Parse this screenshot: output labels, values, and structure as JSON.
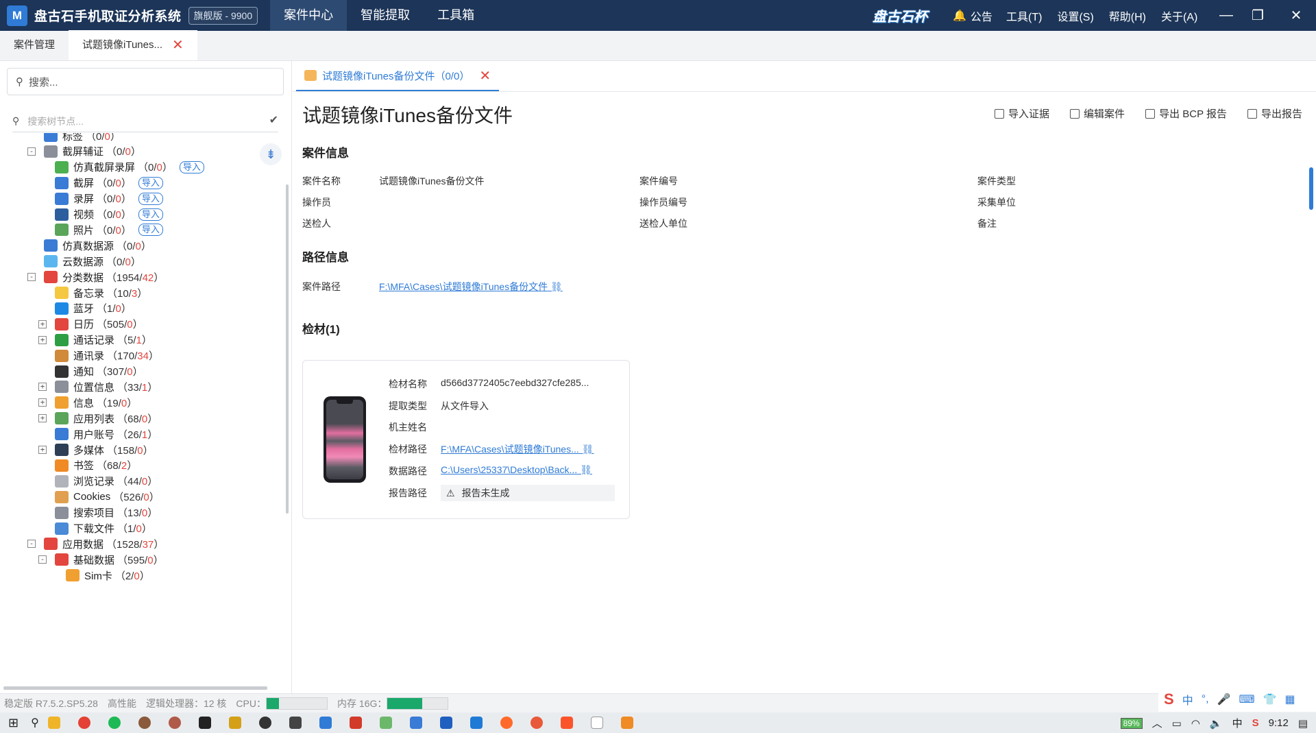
{
  "app": {
    "logo_letter": "M",
    "title": "盘古石手机取证分析系统",
    "edition": "旗舰版 - 9900",
    "brand": "盘古石杯"
  },
  "topnav": [
    "案件中心",
    "智能提取",
    "工具箱"
  ],
  "topbar": {
    "notice": "公告",
    "menus": [
      "工具(T)",
      "设置(S)",
      "帮助(H)",
      "关于(A)"
    ]
  },
  "tabs": [
    {
      "label": "案件管理"
    },
    {
      "label": "试题镜像iTunes..."
    }
  ],
  "left": {
    "search_placeholder": "搜索...",
    "tree_search_placeholder": "搜索树节点...",
    "tree": [
      {
        "label": "标签",
        "a": "0",
        "b": "0",
        "level": 1,
        "toggle": "",
        "color": "#3a7bd5",
        "icon": "tag-icon"
      },
      {
        "label": "截屏辅证",
        "a": "0",
        "b": "0",
        "level": 1,
        "toggle": "-",
        "color": "#8a8f99",
        "icon": "camera-icon"
      },
      {
        "label": "仿真截屏录屏",
        "a": "0",
        "b": "0",
        "level": 2,
        "toggle": "",
        "color": "#4caf50",
        "icon": "screen-record-icon",
        "import": "导入"
      },
      {
        "label": "截屏",
        "a": "0",
        "b": "0",
        "level": 2,
        "toggle": "",
        "color": "#3a7bd5",
        "icon": "screenshot-icon",
        "import": "导入"
      },
      {
        "label": "录屏",
        "a": "0",
        "b": "0",
        "level": 2,
        "toggle": "",
        "color": "#3a7bd5",
        "icon": "record-icon",
        "import": "导入"
      },
      {
        "label": "视频",
        "a": "0",
        "b": "0",
        "level": 2,
        "toggle": "",
        "color": "#2d5e9e",
        "icon": "video-icon",
        "import": "导入"
      },
      {
        "label": "照片",
        "a": "0",
        "b": "0",
        "level": 2,
        "toggle": "",
        "color": "#5aa55a",
        "icon": "photo-icon",
        "import": "导入"
      },
      {
        "label": "仿真数据源",
        "a": "0",
        "b": "0",
        "level": 1,
        "toggle": "",
        "color": "#3a7bd5",
        "icon": "simulation-icon"
      },
      {
        "label": "云数据源",
        "a": "0",
        "b": "0",
        "level": 1,
        "toggle": "",
        "color": "#5bb6f0",
        "icon": "cloud-icon"
      },
      {
        "label": "分类数据",
        "a": "1954",
        "b": "42",
        "level": 1,
        "toggle": "-",
        "color": "#e2463e",
        "icon": "category-icon"
      },
      {
        "label": "备忘录",
        "a": "10",
        "b": "3",
        "level": 2,
        "toggle": "",
        "color": "#f5c842",
        "icon": "memo-icon"
      },
      {
        "label": "蓝牙",
        "a": "1",
        "b": "0",
        "level": 2,
        "toggle": "",
        "color": "#1e88e5",
        "icon": "bluetooth-icon"
      },
      {
        "label": "日历",
        "a": "505",
        "b": "0",
        "level": 2,
        "toggle": "+",
        "color": "#e2463e",
        "icon": "calendar-icon"
      },
      {
        "label": "通话记录",
        "a": "5",
        "b": "1",
        "level": 2,
        "toggle": "+",
        "color": "#2e9e45",
        "icon": "phone-icon"
      },
      {
        "label": "通讯录",
        "a": "170",
        "b": "34",
        "level": 2,
        "toggle": "",
        "color": "#d08a3a",
        "icon": "contacts-icon"
      },
      {
        "label": "通知",
        "a": "307",
        "b": "0",
        "level": 2,
        "toggle": "",
        "color": "#333333",
        "icon": "bell-icon"
      },
      {
        "label": "位置信息",
        "a": "33",
        "b": "1",
        "level": 2,
        "toggle": "+",
        "color": "#8a8f99",
        "icon": "location-icon"
      },
      {
        "label": "信息",
        "a": "19",
        "b": "0",
        "level": 2,
        "toggle": "+",
        "color": "#f0a030",
        "icon": "message-icon"
      },
      {
        "label": "应用列表",
        "a": "68",
        "b": "0",
        "level": 2,
        "toggle": "+",
        "color": "#5aa55a",
        "icon": "app-list-icon"
      },
      {
        "label": "用户账号",
        "a": "26",
        "b": "1",
        "level": 2,
        "toggle": "",
        "color": "#3a7bd5",
        "icon": "user-icon"
      },
      {
        "label": "多媒体",
        "a": "158",
        "b": "0",
        "level": 2,
        "toggle": "+",
        "color": "#2d3e55",
        "icon": "media-icon"
      },
      {
        "label": "书签",
        "a": "68",
        "b": "2",
        "level": 2,
        "toggle": "",
        "color": "#f08a24",
        "icon": "bookmark-icon"
      },
      {
        "label": "浏览记录",
        "a": "44",
        "b": "0",
        "level": 2,
        "toggle": "",
        "color": "#b0b4ba",
        "icon": "history-icon"
      },
      {
        "label": "Cookies",
        "a": "526",
        "b": "0",
        "level": 2,
        "toggle": "",
        "color": "#e0a050",
        "icon": "cookie-icon"
      },
      {
        "label": "搜索项目",
        "a": "13",
        "b": "0",
        "level": 2,
        "toggle": "",
        "color": "#8a8f99",
        "icon": "search-item-icon"
      },
      {
        "label": "下载文件",
        "a": "1",
        "b": "0",
        "level": 2,
        "toggle": "",
        "color": "#4a8ad6",
        "icon": "download-icon"
      },
      {
        "label": "应用数据",
        "a": "1528",
        "b": "37",
        "level": 1,
        "toggle": "-",
        "color": "#e2463e",
        "icon": "app-data-icon"
      },
      {
        "label": "基础数据",
        "a": "595",
        "b": "0",
        "level": 2,
        "toggle": "-",
        "color": "#e2463e",
        "icon": "base-data-icon"
      },
      {
        "label": "Sim卡",
        "a": "2",
        "b": "0",
        "level": 3,
        "toggle": "",
        "color": "#f0a030",
        "icon": "sim-icon"
      }
    ]
  },
  "main": {
    "subtab_label": "试题镜像iTunes备份文件（0/0）",
    "title": "试题镜像iTunes备份文件",
    "actions": [
      "导入证据",
      "编辑案件",
      "导出 BCP 报告",
      "导出报告"
    ],
    "case_info_title": "案件信息",
    "case_info": {
      "name_label": "案件名称",
      "name_value": "试题镜像iTunes备份文件",
      "no_label": "案件编号",
      "type_label": "案件类型",
      "operator_label": "操作员",
      "operator_no_label": "操作员编号",
      "collect_unit_label": "采集单位",
      "sender_label": "送检人",
      "sender_unit_label": "送检人单位",
      "remark_label": "备注"
    },
    "path_info_title": "路径信息",
    "path_label": "案件路径",
    "path_value": "F:\\MFA\\Cases\\试题镜像iTunes备份文件",
    "evidence_title": "检材(1)",
    "evidence": {
      "name_label": "检材名称",
      "name_value": "d566d3772405c7eebd327cfe285...",
      "extract_label": "提取类型",
      "extract_value": "从文件导入",
      "owner_label": "机主姓名",
      "owner_value": "",
      "path_label": "检材路径",
      "path_value": "F:\\MFA\\Cases\\试题镜像iTunes...",
      "data_path_label": "数据路径",
      "data_path_value": "C:\\Users\\25337\\Desktop\\Back...",
      "report_label": "报告路径",
      "report_value": "报告未生成"
    }
  },
  "status": {
    "version": "稳定版  R7.5.2.SP5.28",
    "perf": "高性能",
    "cores": "逻辑处理器：12 核",
    "cpu_label": "CPU：",
    "cpu_fraction": 0.2,
    "mem_label": "内存 16G：",
    "mem_fraction": 0.57
  },
  "taskbar": {
    "battery": "89%",
    "ime_lang": "中",
    "tray_lang": "中",
    "time": "9:12"
  }
}
